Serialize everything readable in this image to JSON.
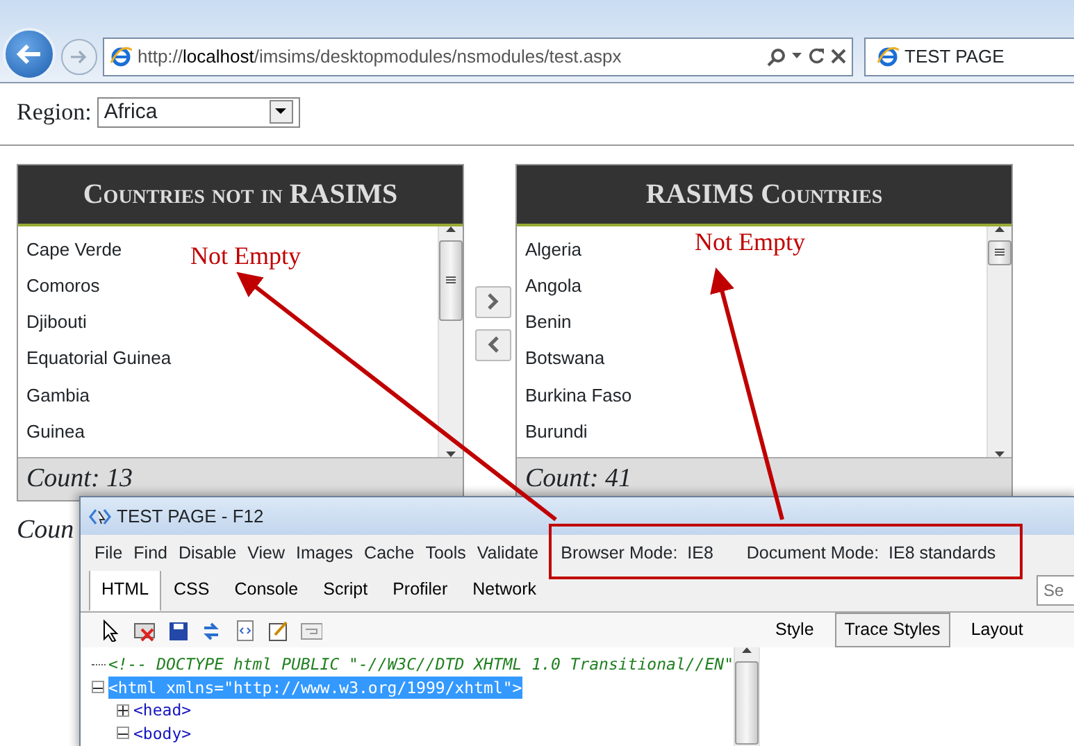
{
  "browser": {
    "address_scheme": "http://",
    "address_host": "localhost",
    "address_path": "/imsims/desktopmodules/nsmodules/test.aspx",
    "tab_title": "TEST PAGE"
  },
  "region": {
    "label": "Region:",
    "value": "Africa"
  },
  "panels": [
    {
      "title": "Countries not in RASIMS",
      "items": [
        "Cape Verde",
        "Comoros",
        "Djibouti",
        "Equatorial Guinea",
        "Gambia",
        "Guinea"
      ],
      "count": "Count: 13",
      "annotation": "Not Empty"
    },
    {
      "title": "RASIMS Countries",
      "items": [
        "Algeria",
        "Angola",
        "Benin",
        "Botswana",
        "Burkina Faso",
        "Burundi"
      ],
      "count": "Count: 41",
      "annotation": "Not Empty"
    }
  ],
  "footer_text": "Coun",
  "devtools": {
    "title": "TEST PAGE - F12",
    "menu": [
      "File",
      "Find",
      "Disable",
      "View",
      "Images",
      "Cache",
      "Tools",
      "Validate"
    ],
    "modes": [
      "Browser Mode:  IE8",
      "Document Mode:  IE8 standards"
    ],
    "tabs": [
      {
        "label": "HTML",
        "selected": true
      },
      {
        "label": "CSS",
        "selected": false
      },
      {
        "label": "Console",
        "selected": false
      },
      {
        "label": "Script",
        "selected": false
      },
      {
        "label": "Profiler",
        "selected": false
      },
      {
        "label": "Network",
        "selected": false
      }
    ],
    "search_placeholder": "Se",
    "side_tabs": [
      {
        "label": "Style",
        "selected": false
      },
      {
        "label": "Trace Styles",
        "selected": true
      },
      {
        "label": "Layout",
        "selected": false
      }
    ],
    "tree": [
      {
        "text": "<!-- DOCTYPE html PUBLIC \"-//W3C//DTD XHTML 1.0 Transitional//EN\"",
        "kind": "comment"
      },
      {
        "text": "<html xmlns=\"http://www.w3.org/1999/xhtml\">",
        "kind": "element",
        "selected": true,
        "expanded": true,
        "children": [
          {
            "text": "<head>",
            "kind": "element",
            "selected": false,
            "expanded": false
          },
          {
            "text": "<body>",
            "kind": "element",
            "selected": false,
            "expanded": true
          }
        ]
      }
    ]
  }
}
